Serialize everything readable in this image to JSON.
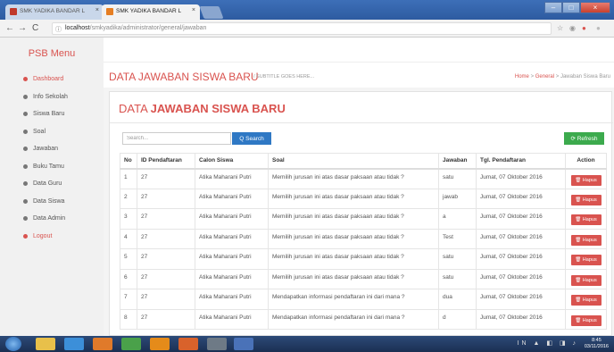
{
  "browser": {
    "tabs": [
      {
        "label": "SMK YADIKA BANDAR L"
      },
      {
        "label": "SMK YADIKA BANDAR L"
      }
    ],
    "close_glyph": "×",
    "back_glyph": "←",
    "forward_glyph": "→",
    "reload_glyph": "C",
    "info_glyph": "ⓘ",
    "url_host": "localhost",
    "url_path": "/smkyadika/administrator/general/jawaban",
    "star_glyph": "☆",
    "win_minimize": "–",
    "win_maximize": "□",
    "win_close": "×"
  },
  "sidebar": {
    "brand": "PSB Menu",
    "items": [
      {
        "label": "Dashboard"
      },
      {
        "label": "Info Sekolah"
      },
      {
        "label": "Siswa Baru"
      },
      {
        "label": "Soal"
      },
      {
        "label": "Jawaban"
      },
      {
        "label": "Buku Tamu"
      },
      {
        "label": "Data Guru"
      },
      {
        "label": "Data Siswa"
      },
      {
        "label": "Data Admin"
      },
      {
        "label": "Logout"
      }
    ]
  },
  "header": {
    "title": "DATA JAWABAN SISWA BARU",
    "subtitle": "/ SUBTITLE GOES HERE...",
    "breadcrumb": {
      "home": "Home",
      "sep": ">",
      "section": "General",
      "current": "Jawaban Siswa Baru"
    }
  },
  "panel": {
    "title_lite": "DATA ",
    "title_bold": "JAWABAN SISWA BARU",
    "search_placeholder": "Search...",
    "search_button": "Q Search",
    "refresh_button": "⟳ Refresh"
  },
  "table": {
    "columns": [
      "No",
      "ID Pendaftaran",
      "Calon Siswa",
      "Soal",
      "Jawaban",
      "Tgl. Pendaftaran",
      "Action"
    ],
    "action_label": "🗑 Hapus",
    "rows": [
      {
        "no": "1",
        "id": "27",
        "nama": "Atika Maharani Putri",
        "soal": "Memilih jurusan ini atas dasar paksaan atau tidak ?",
        "jawaban": "satu",
        "tgl": "Jumat, 07 Oktober 2016"
      },
      {
        "no": "2",
        "id": "27",
        "nama": "Atika Maharani Putri",
        "soal": "Memilih jurusan ini atas dasar paksaan atau tidak ?",
        "jawaban": "jawab",
        "tgl": "Jumat, 07 Oktober 2016"
      },
      {
        "no": "3",
        "id": "27",
        "nama": "Atika Maharani Putri",
        "soal": "Memilih jurusan ini atas dasar paksaan atau tidak ?",
        "jawaban": "a",
        "tgl": "Jumat, 07 Oktober 2016"
      },
      {
        "no": "4",
        "id": "27",
        "nama": "Atika Maharani Putri",
        "soal": "Memilih jurusan ini atas dasar paksaan atau tidak ?",
        "jawaban": "Test",
        "tgl": "Jumat, 07 Oktober 2016"
      },
      {
        "no": "5",
        "id": "27",
        "nama": "Atika Maharani Putri",
        "soal": "Memilih jurusan ini atas dasar paksaan atau tidak ?",
        "jawaban": "satu",
        "tgl": "Jumat, 07 Oktober 2016"
      },
      {
        "no": "6",
        "id": "27",
        "nama": "Atika Maharani Putri",
        "soal": "Memilih jurusan ini atas dasar paksaan atau tidak ?",
        "jawaban": "satu",
        "tgl": "Jumat, 07 Oktober 2016"
      },
      {
        "no": "7",
        "id": "27",
        "nama": "Atika Maharani Putri",
        "soal": "Mendapatkan informasi pendaftaran ini dari mana ?",
        "jawaban": "dua",
        "tgl": "Jumat, 07 Oktober 2016"
      },
      {
        "no": "8",
        "id": "27",
        "nama": "Atika Maharani Putri",
        "soal": "Mendapatkan informasi pendaftaran ini dari mana ?",
        "jawaban": "d",
        "tgl": "Jumat, 07 Oktober 2016"
      }
    ]
  },
  "taskbar": {
    "time": "8:45",
    "date": "03/11/2016",
    "lang": "IN"
  },
  "colors": {
    "accent": "#d9534f",
    "search": "#2f78c4",
    "refresh": "#3caa4d"
  }
}
